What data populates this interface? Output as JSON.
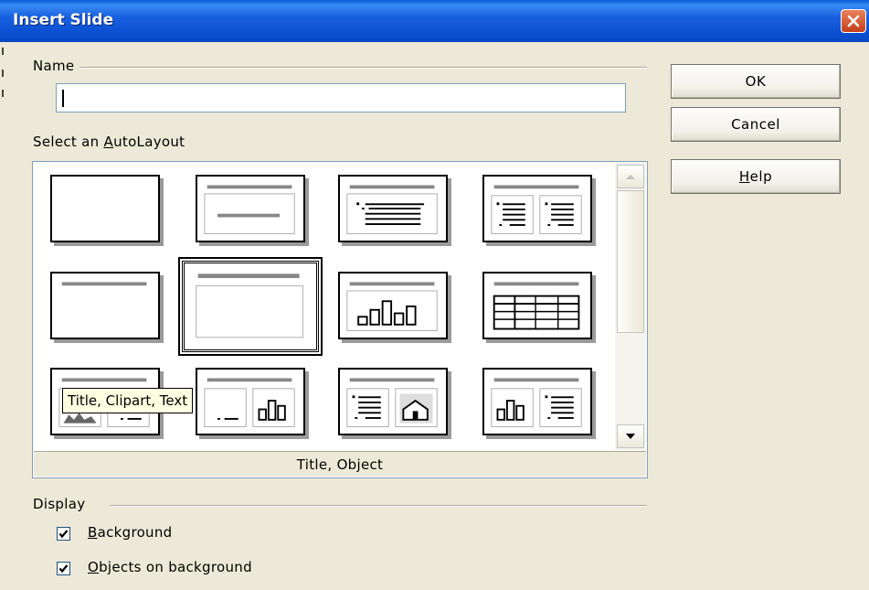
{
  "window": {
    "title": "Insert Slide"
  },
  "name_group": {
    "label": "Name",
    "value": ""
  },
  "buttons": {
    "ok": "OK",
    "cancel": "Cancel",
    "help_prefix": "",
    "help_accel": "H",
    "help_rest": "elp"
  },
  "autolayout": {
    "label_prefix": "Select an ",
    "label_accel": "A",
    "label_rest": "utoLayout",
    "selected_caption": "Title, Object",
    "tooltip": "Title, Clipart, Text",
    "layouts": [
      {
        "icon": "blank-slide-icon"
      },
      {
        "icon": "title-slide-icon"
      },
      {
        "icon": "title-text-icon"
      },
      {
        "icon": "title-2-text-icon"
      },
      {
        "icon": "title-only-icon"
      },
      {
        "icon": "title-object-icon",
        "selected": true
      },
      {
        "icon": "title-chart-icon"
      },
      {
        "icon": "title-spreadsheet-icon"
      },
      {
        "icon": "title-clipart-text-icon"
      },
      {
        "icon": "title-text-chart-icon"
      },
      {
        "icon": "title-text-clipart-icon"
      },
      {
        "icon": "title-chart-text-icon"
      }
    ]
  },
  "display": {
    "label": "Display",
    "background": {
      "accel": "B",
      "rest": "ackground",
      "checked": true
    },
    "objects_on_background": {
      "accel": "O",
      "rest": "bjects on background",
      "checked": true
    }
  }
}
